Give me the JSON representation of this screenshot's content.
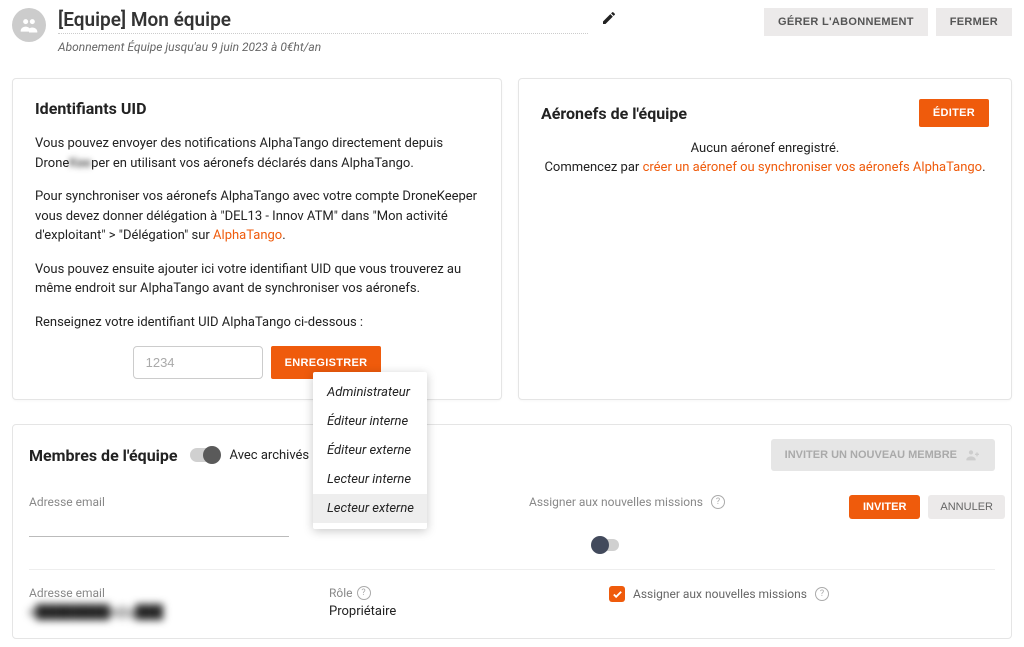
{
  "header": {
    "title": "[Equipe] Mon équipe",
    "subtitle": "Abonnement Équipe jusqu'au 9 juin 2023 à 0€ht/an",
    "manage_subscription": "GÉRER L'ABONNEMENT",
    "close": "FERMER"
  },
  "uid_card": {
    "title": "Identifiants UID",
    "p1_a": "Vous pouvez envoyer des notifications AlphaTango directement depuis Drone",
    "p1_b": "per en utilisant vos aéronefs déclarés dans AlphaTango.",
    "p2_a": "Pour synchroniser vos aéronefs AlphaTango avec votre compte DroneKeeper vous devez donner délégation à \"DEL13 - Innov ATM\" dans \"Mon activité d'exploitant\" > \"Délégation\" sur ",
    "p2_link": "AlphaTango",
    "p2_b": ".",
    "p3": "Vous pouvez ensuite ajouter ici votre identifiant UID que vous trouverez au même endroit sur AlphaTango avant de synchroniser vos aéronefs.",
    "p4": "Renseignez votre identifiant UID AlphaTango ci-dessous :",
    "placeholder": "1234",
    "save": "ENREGISTRER"
  },
  "aircraft_card": {
    "title": "Aéronefs de l'équipe",
    "edit": "ÉDITER",
    "none": "Aucun aéronef enregistré.",
    "start_prefix": "Commencez par ",
    "start_link": "créer un aéronef ou synchroniser vos aéronefs AlphaTango",
    "start_suffix": "."
  },
  "members": {
    "title": "Membres de l'équipe",
    "with_archived": "Avec archivés",
    "invite_new": "INVITER UN NOUVEAU MEMBRE",
    "email_label": "Adresse email",
    "role_label": "Rôle",
    "assign_label": "Assigner aux nouvelles missions",
    "invite": "INVITER",
    "cancel": "ANNULER",
    "existing": {
      "email": "e████████e@g███",
      "role": "Propriétaire"
    }
  },
  "role_dropdown": {
    "items": [
      "Administrateur",
      "Éditeur interne",
      "Éditeur externe",
      "Lecteur interne",
      "Lecteur externe"
    ],
    "selected_index": 4
  }
}
